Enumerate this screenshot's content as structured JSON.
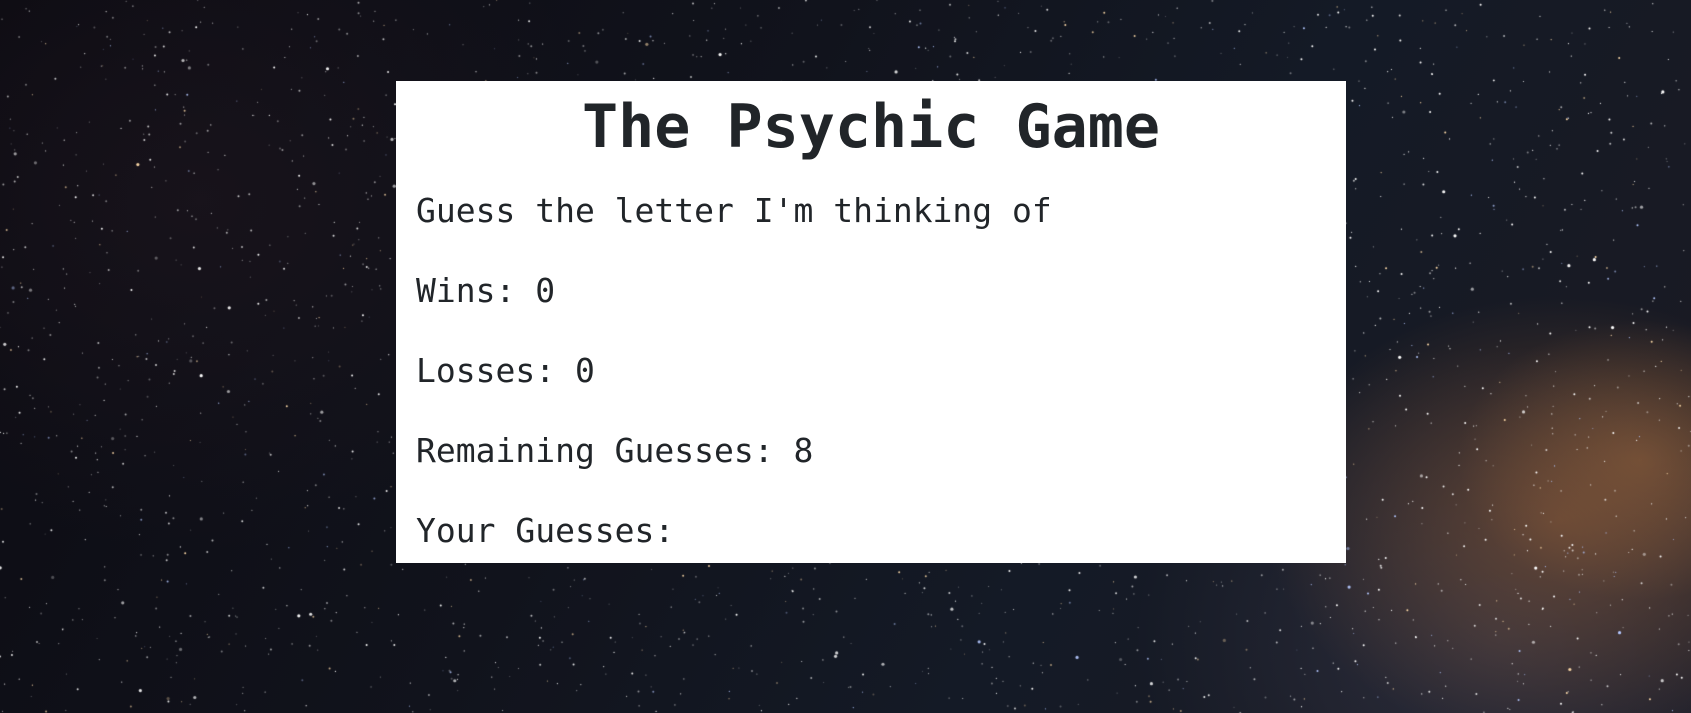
{
  "game": {
    "title": "The Psychic Game",
    "instruction": "Guess the letter I'm thinking of",
    "wins_label": "Wins: ",
    "wins": "0",
    "losses_label": "Losses: ",
    "losses": "0",
    "remaining_label": "Remaining Guesses: ",
    "remaining": "8",
    "guesses_label": "Your Guesses: ",
    "guesses": ""
  },
  "colors": {
    "card_background": "#ffffff",
    "text": "#212529",
    "background": "starry night sky"
  }
}
